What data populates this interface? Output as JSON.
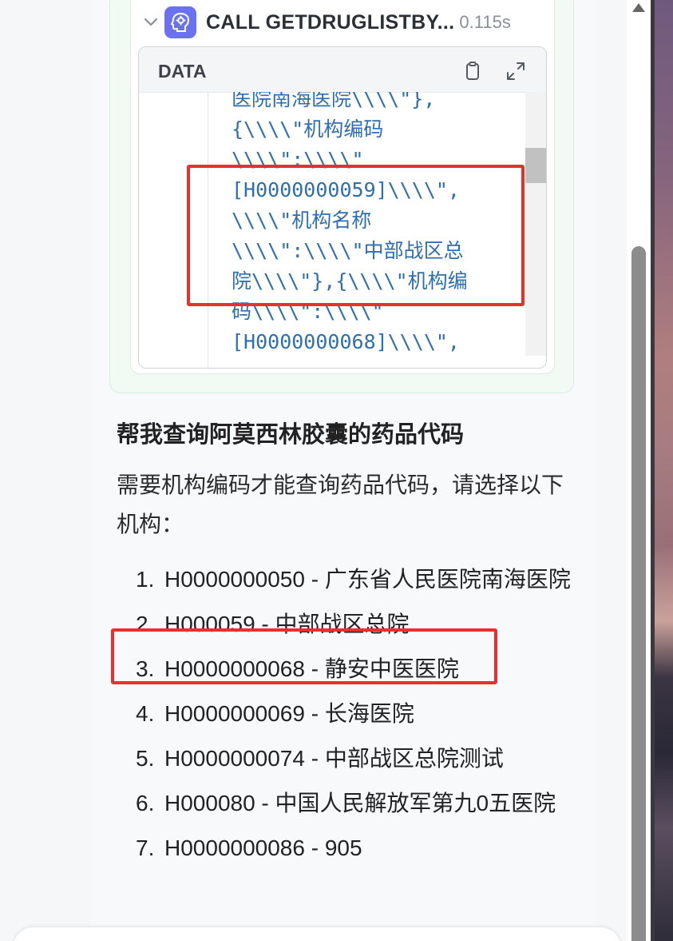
{
  "tool_call": {
    "name": "CALL GETDRUGLISTBY...",
    "duration": "0.115s",
    "icon": "brain-gear-icon",
    "data_label": "DATA",
    "code_lines": [
      "医院南海医院\\\\\\\\\"},",
      "{\\\\\\\\\"机构编码",
      "\\\\\\\\\":\\\\\\\\\"",
      "[H0000000059]\\\\\\\\\",",
      "\\\\\\\\\"机构名称",
      "\\\\\\\\\":\\\\\\\\\"中部战区总",
      "院\\\\\\\\\"},{\\\\\\\\\"机构编",
      "码\\\\\\\\\":\\\\\\\\\"",
      "[H0000000068]\\\\\\\\\","
    ]
  },
  "message": {
    "title": "帮我查询阿莫西林胶囊的药品代码",
    "intro": "需要机构编码才能查询药品代码，请选择以下机构：",
    "items": [
      {
        "num": "1.",
        "text": "H0000000050 - 广东省人民医院南海医院"
      },
      {
        "num": "2.",
        "text": "H000059 - 中部战区总院"
      },
      {
        "num": "3.",
        "text": "H0000000068 - 静安中医医院"
      },
      {
        "num": "4.",
        "text": "H0000000069 - 长海医院"
      },
      {
        "num": "5.",
        "text": "H0000000074 - 中部战区总院测试"
      },
      {
        "num": "6.",
        "text": "H000080 - 中国人民解放军第九0五医院"
      },
      {
        "num": "7.",
        "text": "H0000000086 - 905"
      }
    ]
  },
  "colors": {
    "accent": "#6b72f2",
    "highlight": "#e8302f",
    "code": "#2f6fb1"
  }
}
